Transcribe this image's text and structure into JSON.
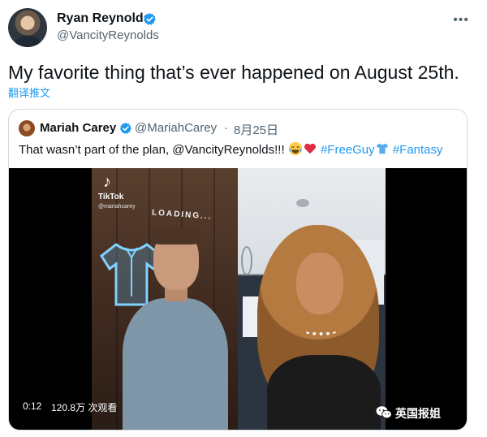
{
  "author": {
    "name": "Ryan Reynolds",
    "handle": "@VancityReynolds"
  },
  "tweet": {
    "text": "My favorite thing that’s ever happened on August 25th.",
    "translate_label": "翻译推文"
  },
  "quoted": {
    "name": "Mariah Carey",
    "handle": "@MariahCarey",
    "separator": "·",
    "date": "8月25日",
    "text_parts": {
      "before": "That wasn’t part of the plan, @VancityReynolds!!! ",
      "tag1": "#FreeGuy",
      "tag2": "#Fantasy"
    },
    "video": {
      "tiktok_text": "TikTok",
      "tiktok_user": "@mariahcarey",
      "loading_text": "LOADING...",
      "time": "0:12",
      "views": "120.8万 次观看"
    }
  },
  "watermark": "英国报姐",
  "colors": {
    "accent": "#1d9bf0",
    "secondary_text": "#536471",
    "border": "#cfd9de"
  },
  "icons": {
    "verified": "verified-badge-icon",
    "more": "more-options-icon",
    "laugh_emoji": "face-with-tears-of-joy",
    "heart_emoji": "red-heart",
    "shirt_emoji": "t-shirt",
    "tiktok": "tiktok-logo-icon",
    "wechat": "wechat-icon"
  }
}
